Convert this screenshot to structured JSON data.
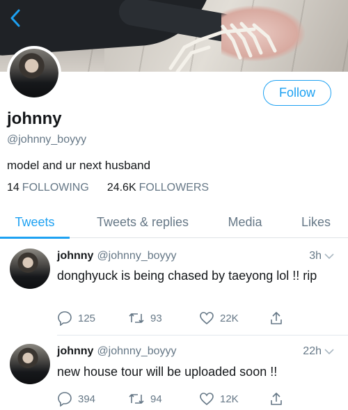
{
  "nav": {
    "back_icon": "chevron-left-icon"
  },
  "profile": {
    "name": "johnny",
    "handle": "@johnny_boyyy",
    "bio": "model and ur next husband",
    "follow_label": "Follow",
    "following_count": "14",
    "following_label": "FOLLOWING",
    "followers_count": "24.6K",
    "followers_label": "FOLLOWERS"
  },
  "tabs": [
    {
      "label": "Tweets",
      "active": true
    },
    {
      "label": "Tweets & replies",
      "active": false
    },
    {
      "label": "Media",
      "active": false
    },
    {
      "label": "Likes",
      "active": false
    }
  ],
  "tweets": [
    {
      "name": "johnny",
      "handle": "@johnny_boyyy",
      "time": "3h",
      "text": "donghyuck is being chased by taeyong lol !! rip",
      "replies": "125",
      "retweets": "93",
      "likes": "22K"
    },
    {
      "name": "johnny",
      "handle": "@johnny_boyyy",
      "time": "22h",
      "text": "new house tour will be uploaded soon !!",
      "replies": "394",
      "retweets": "94",
      "likes": "12K"
    }
  ],
  "colors": {
    "accent": "#1da1f2",
    "secondary_text": "#657786",
    "divider": "#e1e8ed"
  }
}
